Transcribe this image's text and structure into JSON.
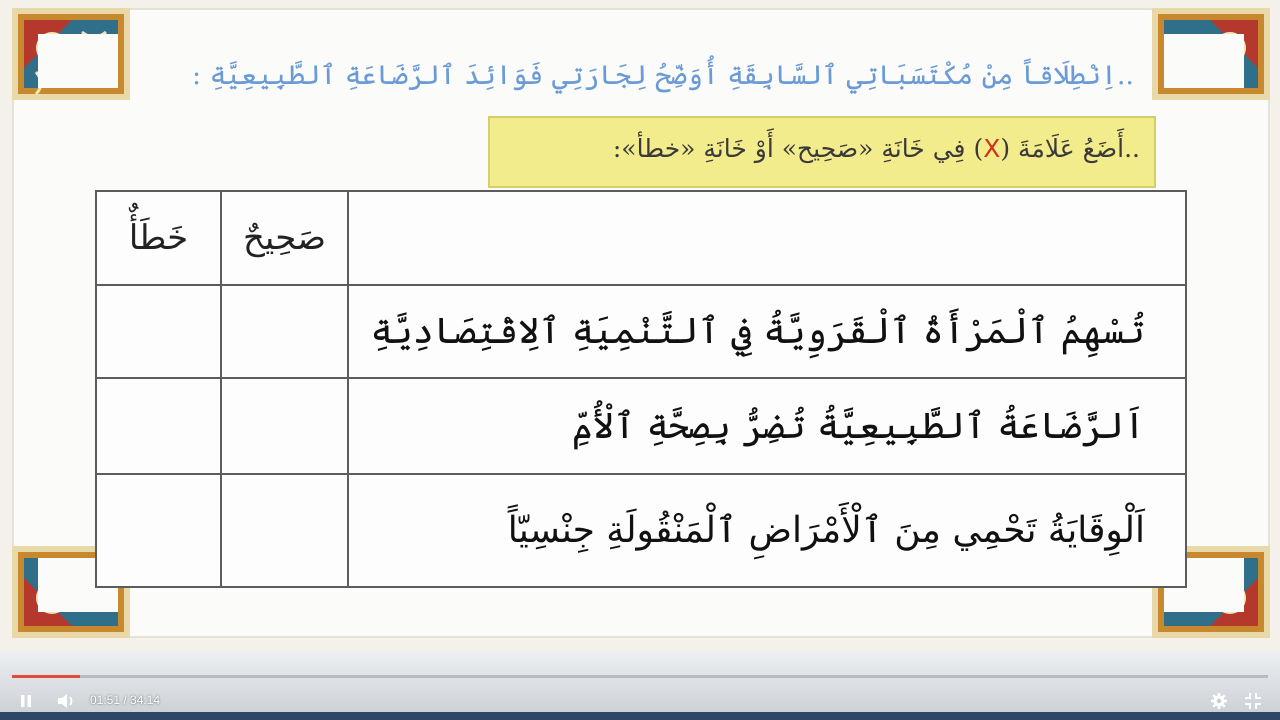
{
  "lesson": {
    "intro_text": "..اِنْطِلَاقاً مِنْ مُكْتَسَبَاتِي ٱلسَّابِقَةِ أُوَضِّحُ لِجَارَتِي فَوَائِدَ ٱلرَّضَاعَةِ ٱلطَّبِيعِيَّةِ :",
    "instruction": {
      "before": "..أَضَعُ عَلَامَةَ (",
      "mark": "X",
      "after": ") فِي خَانَةِ «صَحِيح» أَوْ خَانَةِ «خطأ»:"
    }
  },
  "table": {
    "headers": {
      "correct": "صَحِيحٌ",
      "wrong": "خَطَأٌ"
    },
    "rows": [
      {
        "statement": "تُسْهِمُ ٱلْمَرْأَةُ ٱلْقَرَوِيَّةُ فِي ٱلتَّنْمِيَةِ ٱلِاقْتِصَادِيَّةِ"
      },
      {
        "statement": "اَلرَّضَاعَةُ ٱلطَّبِيعِيَّةُ تُضِرُّ بِصِحَّةِ ٱلْأُمِّ"
      },
      {
        "statement": "اَلْوِقَايَةُ تَحْمِي مِنَ ٱلْأَمْرَاضِ ٱلْمَنْقُولَةِ جِنْسِيّاً"
      }
    ]
  },
  "player": {
    "current_time": "01:51",
    "duration": "34:14",
    "time_display": "01:51 / 34:14",
    "progress_fraction": 0.054,
    "icons": [
      "pause-icon",
      "volume-icon",
      "gear-icon",
      "fullscreen-icon"
    ],
    "accent_color": "#e24a3b"
  }
}
